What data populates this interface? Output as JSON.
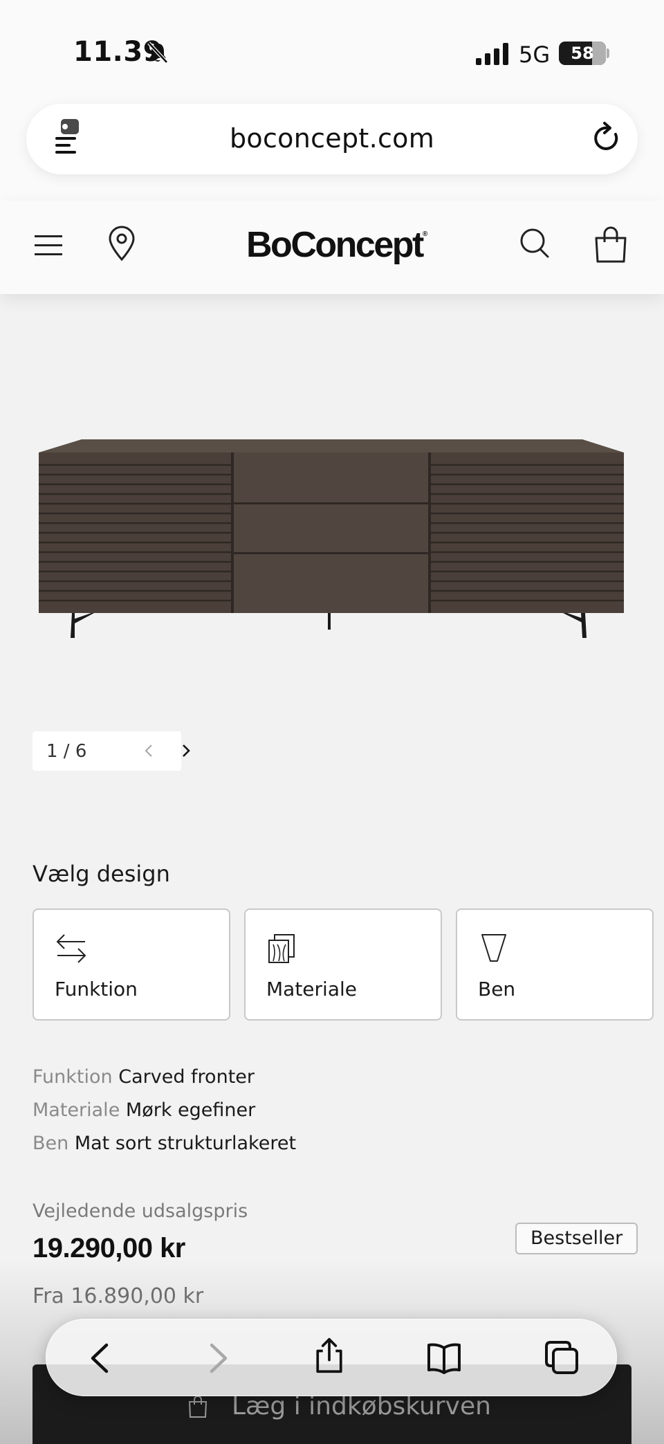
{
  "status_bar": {
    "time": "11.39",
    "network": "5G",
    "battery": "58"
  },
  "browser": {
    "url": "boconcept.com"
  },
  "site": {
    "logo": "BoConcept",
    "logo_mark": "®"
  },
  "gallery": {
    "counter": "1 / 6"
  },
  "design": {
    "title": "Vælg design",
    "options": [
      {
        "label": "Funktion",
        "icon": "arrows-swap-icon"
      },
      {
        "label": "Materiale",
        "icon": "material-swatch-icon"
      },
      {
        "label": "Ben",
        "icon": "table-leg-icon"
      }
    ],
    "specs": [
      {
        "key": "Funktion",
        "value": "Carved fronter"
      },
      {
        "key": "Materiale",
        "value": "Mørk egefiner"
      },
      {
        "key": "Ben",
        "value": "Mat sort strukturlakeret"
      }
    ]
  },
  "pricing": {
    "label": "Vejledende udsalgspris",
    "price": "19.290,00 kr",
    "from": "Fra 16.890,00 kr",
    "badge": "Bestseller"
  },
  "cart": {
    "label": "Læg i indkøbskurven"
  },
  "colors": {
    "background": "#f2f2f2",
    "cabinet": "#4a4039",
    "button": "#1b1b1b"
  }
}
